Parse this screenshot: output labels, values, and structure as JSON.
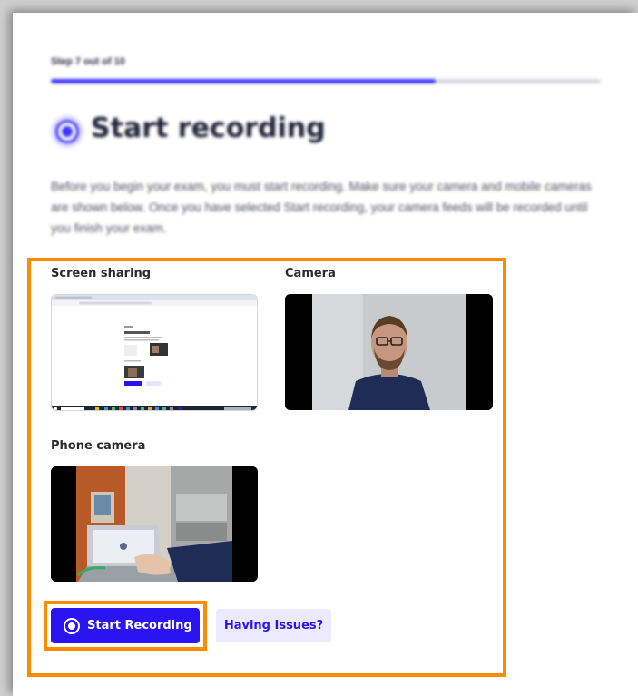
{
  "header": {
    "step_text": "Step 7 out of 10",
    "progress_fraction": 0.7,
    "title": "Start recording",
    "intro": "Before you begin your exam, you must start recording. Make sure your camera and mobile cameras are shown below. Once you have selected Start recording, your camera feeds will be recorded until you finish your exam."
  },
  "feeds": {
    "screen_label": "Screen sharing",
    "camera_label": "Camera",
    "phone_label": "Phone camera"
  },
  "actions": {
    "start_label": "Start Recording",
    "issues_label": "Having Issues?"
  },
  "colors": {
    "accent": "#2a15f2",
    "progress": "#3d33ff",
    "highlight": "#ff8c00"
  }
}
